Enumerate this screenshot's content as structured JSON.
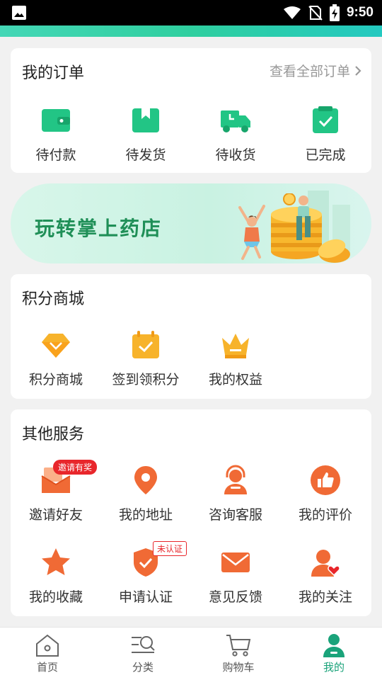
{
  "status_bar": {
    "time": "9:50"
  },
  "orders": {
    "title": "我的订单",
    "view_all": "查看全部订单",
    "items": [
      {
        "label": "待付款",
        "icon": "wallet-icon"
      },
      {
        "label": "待发货",
        "icon": "box-icon"
      },
      {
        "label": "待收货",
        "icon": "truck-icon"
      },
      {
        "label": "已完成",
        "icon": "check-clipboard-icon"
      }
    ]
  },
  "banner": {
    "text": "玩转掌上药店"
  },
  "points": {
    "title": "积分商城",
    "items": [
      {
        "label": "积分商城",
        "icon": "diamond-icon"
      },
      {
        "label": "签到领积分",
        "icon": "calendar-check-icon"
      },
      {
        "label": "我的权益",
        "icon": "crown-icon"
      }
    ]
  },
  "services": {
    "title": "其他服务",
    "items": [
      {
        "label": "邀请好友",
        "icon": "invite-icon",
        "badge": "邀请有奖"
      },
      {
        "label": "我的地址",
        "icon": "location-pin-icon"
      },
      {
        "label": "咨询客服",
        "icon": "customer-service-icon"
      },
      {
        "label": "我的评价",
        "icon": "thumbs-up-icon"
      },
      {
        "label": "我的收藏",
        "icon": "star-icon"
      },
      {
        "label": "申请认证",
        "icon": "shield-check-icon",
        "badge": "未认证"
      },
      {
        "label": "意见反馈",
        "icon": "mail-icon"
      },
      {
        "label": "我的关注",
        "icon": "user-heart-icon"
      }
    ]
  },
  "tabbar": {
    "items": [
      {
        "label": "首页",
        "icon": "home-icon"
      },
      {
        "label": "分类",
        "icon": "category-search-icon"
      },
      {
        "label": "购物车",
        "icon": "cart-icon"
      },
      {
        "label": "我的",
        "icon": "user-icon",
        "active": true
      }
    ]
  },
  "colors": {
    "accent_green": "#1aa37a",
    "order_icon_green": "#22c585",
    "points_icon_orange": "#f7b32b",
    "service_icon_red": "#f06a35",
    "badge_red": "#e8262b"
  }
}
